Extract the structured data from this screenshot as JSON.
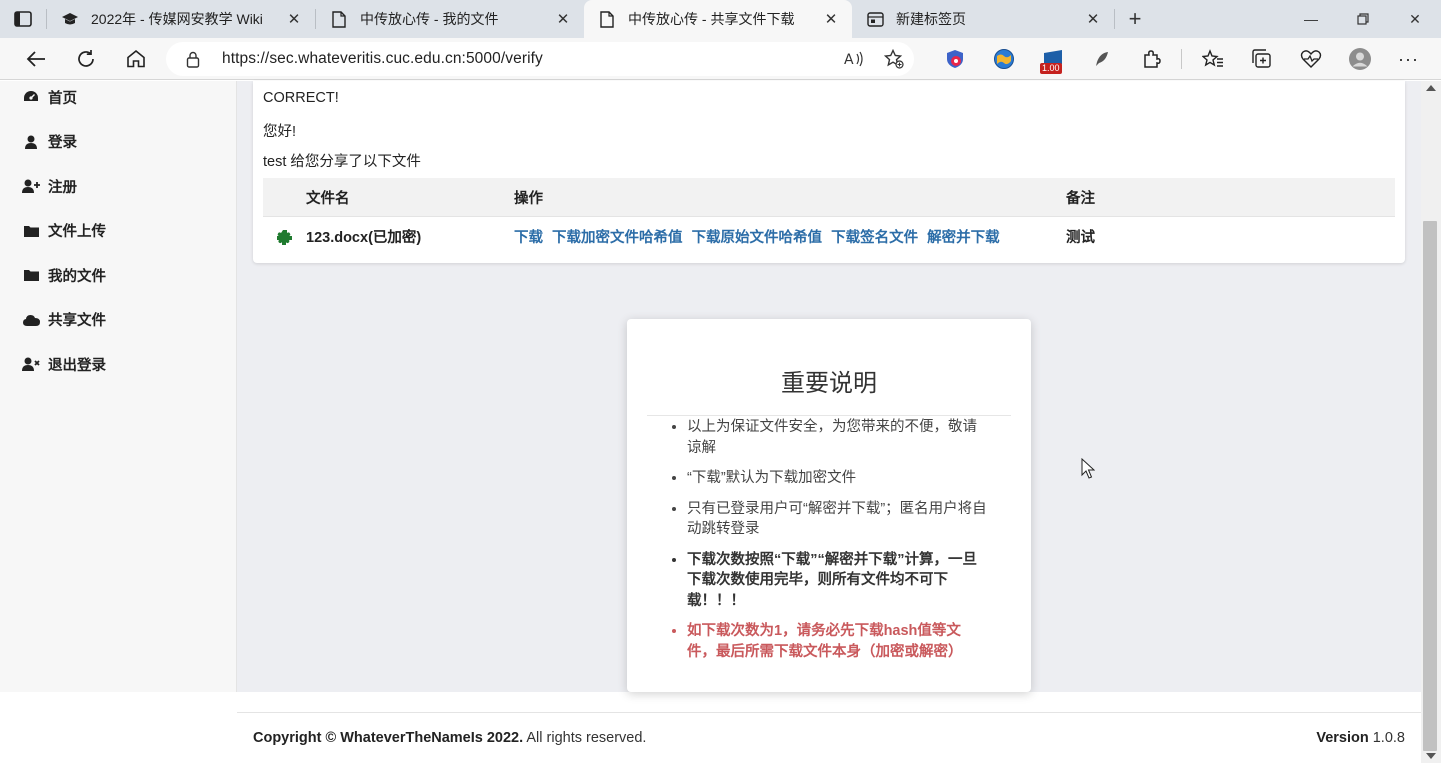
{
  "browser": {
    "tabs": [
      {
        "title": "2022年 - 传媒网安教学 Wiki",
        "icon": "graduation-cap-icon",
        "active": false
      },
      {
        "title": "中传放心传 - 我的文件",
        "icon": "page-icon",
        "active": false
      },
      {
        "title": "中传放心传 - 共享文件下载",
        "icon": "page-icon",
        "active": true
      },
      {
        "title": "新建标签页",
        "icon": "newtab-page-icon",
        "active": false
      }
    ],
    "url": "https://sec.whateveritis.cuc.edu.cn:5000/verify",
    "extension_badge": "1.00"
  },
  "sidebar": {
    "items": [
      {
        "label": "首页",
        "icon": "dashboard-icon"
      },
      {
        "label": "登录",
        "icon": "user-icon"
      },
      {
        "label": "注册",
        "icon": "user-plus-icon"
      },
      {
        "label": "文件上传",
        "icon": "folder-icon"
      },
      {
        "label": "我的文件",
        "icon": "folder-icon"
      },
      {
        "label": "共享文件",
        "icon": "cloud-icon"
      },
      {
        "label": "退出登录",
        "icon": "user-times-icon"
      }
    ]
  },
  "main": {
    "status": "CORRECT!",
    "greeting": "您好!",
    "share_msg": "test 给您分享了以下文件",
    "table": {
      "headers": {
        "name": "文件名",
        "ops": "操作",
        "note": "备注"
      },
      "rows": [
        {
          "name": "123.docx(已加密)",
          "ops": [
            "下载",
            "下载加密文件哈希值",
            "下载原始文件哈希值",
            "下载签名文件",
            "解密并下载"
          ],
          "note": "测试"
        }
      ]
    }
  },
  "notice": {
    "title": "重要说明",
    "items": [
      "以上为保证文件安全，为您带来的不便，敬请谅解",
      "“下载”默认为下载加密文件",
      "只有已登录用户可“解密并下载”；匿名用户将自动跳转登录",
      "下载次数按照“下载”“解密并下载”计算，一旦下载次数使用完毕，则所有文件均不可下载！！！",
      "如下载次数为1，请务必先下载hash值等文件，最后所需下载文件本身（加密或解密）"
    ]
  },
  "footer": {
    "copyright_bold": "Copyright © WhateverTheNameIs 2022.",
    "copyright_rest": " All rights reserved.",
    "version_label": "Version",
    "version_value": " 1.0.8"
  }
}
